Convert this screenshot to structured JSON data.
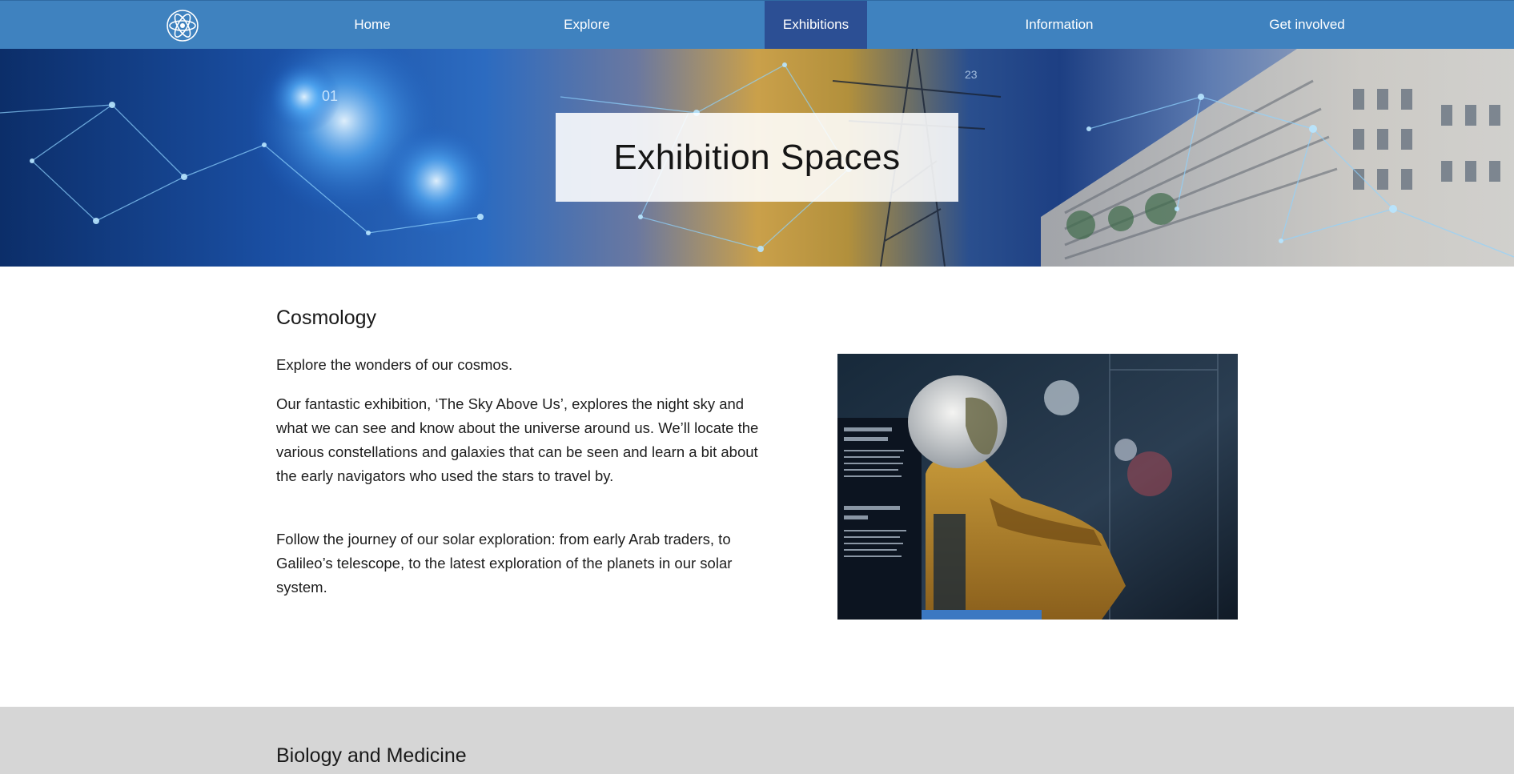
{
  "nav": {
    "items": [
      {
        "label": "Home"
      },
      {
        "label": "Explore"
      },
      {
        "label": "Exhibitions"
      },
      {
        "label": "Information"
      },
      {
        "label": "Get involved"
      }
    ],
    "active": "Exhibitions",
    "logo_icon": "atom-icon"
  },
  "hero": {
    "title": "Exhibition Spaces",
    "numbers": [
      "01",
      "23"
    ]
  },
  "sections": {
    "cosmology": {
      "title": "Cosmology",
      "paragraphs": [
        "Explore the wonders of our cosmos.",
        "Our fantastic exhibition, ‘The Sky Above Us’, explores the night sky and what we can see and know about the universe around us. We’ll locate the various constellations and galaxies that can be seen and learn a bit about the early navigators who used the stars to travel by.",
        "Follow the journey of our solar exploration: from early Arab traders, to Galileo’s telescope, to the latest exploration of the planets in our solar system."
      ]
    },
    "biology": {
      "title": "Biology and Medicine"
    }
  },
  "colors": {
    "nav_bg": "#3f82bf",
    "nav_active_bg": "#2c4f94",
    "grey_section_bg": "#d6d6d6"
  }
}
